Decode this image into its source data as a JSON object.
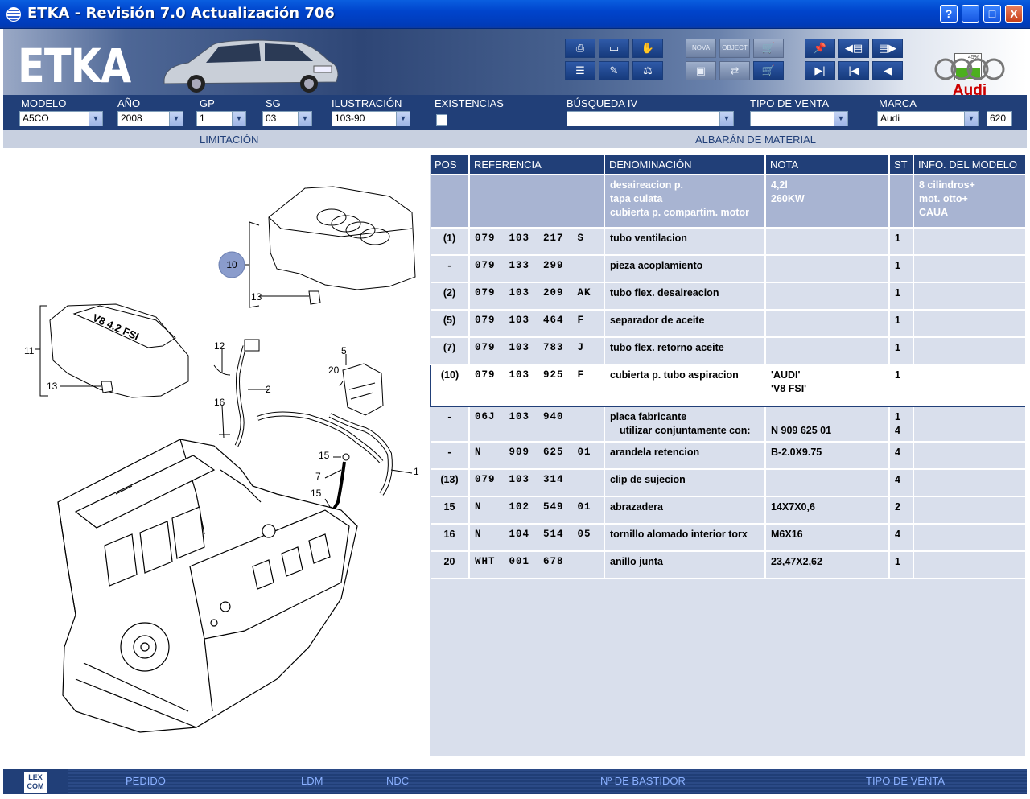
{
  "window": {
    "title": "ETKA - Revisión 7.0 Actualización 706",
    "help_label": "?",
    "minimize_label": "_",
    "maximize_label": "□",
    "close_label": "X"
  },
  "banner": {
    "logo_text": "ETKA",
    "brand_text": "Audi",
    "battery_percent": 45,
    "battery_label": "45%",
    "grey_btn_1": "NOVA",
    "grey_btn_2": "OBJECT"
  },
  "selectors": {
    "modelo": {
      "label": "MODELO",
      "value": "A5CO"
    },
    "anio": {
      "label": "AÑO",
      "value": "2008"
    },
    "gp": {
      "label": "GP",
      "value": "1"
    },
    "sg": {
      "label": "SG",
      "value": "03"
    },
    "ilustracion": {
      "label": "ILUSTRACIÓN",
      "value": "103-90"
    },
    "existencias": {
      "label": "EXISTENCIAS"
    },
    "busqueda": {
      "label": "BÚSQUEDA IV",
      "value": ""
    },
    "tipo_venta": {
      "label": "TIPO DE VENTA",
      "value": ""
    },
    "marca": {
      "label": "MARCA",
      "value": "Audi"
    },
    "code": "620"
  },
  "subheader": {
    "left": "LIMITACIÓN",
    "right": "ALBARÁN DE MATERIAL"
  },
  "table": {
    "headers": {
      "pos": "POS",
      "ref": "REFERENCIA",
      "den": "DENOMINACIÓN",
      "nota": "NOTA",
      "st": "ST",
      "info": "INFO. DEL MODELO"
    },
    "info_row": {
      "den1": "desaireacion p.",
      "den2": "tapa culata",
      "den3": "cubierta p. compartim. motor",
      "nota1": "4,2l",
      "nota2": "260KW",
      "info1": "8 cilindros+",
      "info2": "mot. otto+",
      "info3": "CAUA"
    },
    "rows": [
      {
        "pos": "(1)",
        "ref": "079  103  217  S",
        "den": "tubo ventilacion",
        "nota": "",
        "st": "1"
      },
      {
        "pos": "-",
        "ref": "079  133  299",
        "den": "pieza acoplamiento",
        "nota": "",
        "st": "1"
      },
      {
        "pos": "(2)",
        "ref": "079  103  209  AK",
        "den": "tubo flex. desaireacion",
        "nota": "",
        "st": "1"
      },
      {
        "pos": "(5)",
        "ref": "079  103  464  F",
        "den": "separador de aceite",
        "nota": "",
        "st": "1"
      },
      {
        "pos": "(7)",
        "ref": "079  103  783  J",
        "den": "tubo flex. retorno aceite",
        "nota": "",
        "st": "1"
      }
    ],
    "selected_row": {
      "pos": "(10)",
      "ref": "079  103  925  F",
      "den": "cubierta p. tubo aspiracion",
      "nota1": "'AUDI'",
      "nota2": "'V8   FSI'",
      "st": "1"
    },
    "placa_row": {
      "pos": "-",
      "ref": "06J  103  940",
      "den1": "placa fabricante",
      "den2": "utilizar conjuntamente con:",
      "nota": "N   909 625 01",
      "st1": "1",
      "st2": "4"
    },
    "rows2": [
      {
        "pos": "-",
        "ref": "N    909  625  01",
        "den": "arandela retencion",
        "nota": "B-2.0X9.75",
        "st": "4"
      },
      {
        "pos": "(13)",
        "ref": "079  103  314",
        "den": "clip de sujecion",
        "nota": "",
        "st": "4"
      },
      {
        "pos": "15",
        "ref": "N    102  549  01",
        "den": "abrazadera",
        "nota": "14X7X0,6",
        "st": "2"
      },
      {
        "pos": "16",
        "ref": "N    104  514  05",
        "den": "tornillo alomado interior torx",
        "nota": "M6X16",
        "st": "4"
      },
      {
        "pos": "20",
        "ref": "WHT  001  678",
        "den": "anillo junta",
        "nota": "23,47X2,62",
        "st": "1"
      }
    ]
  },
  "illustration": {
    "callouts": {
      "c10": "10",
      "c13a": "13",
      "c11": "11",
      "c13b": "13",
      "c12": "12",
      "c2": "2",
      "c16": "16",
      "c5": "5",
      "c20": "20",
      "c15a": "15",
      "c7": "7",
      "c15b": "15",
      "c1": "1"
    },
    "cover_text": "V8 4.2 FSI"
  },
  "footer": {
    "lex_line1": "LEX",
    "lex_line2": "COM",
    "pedido": "PEDIDO",
    "ldm": "LDM",
    "ndc": "NDC",
    "bastidor": "Nº DE BASTIDOR",
    "tipo_venta": "TIPO DE VENTA"
  }
}
